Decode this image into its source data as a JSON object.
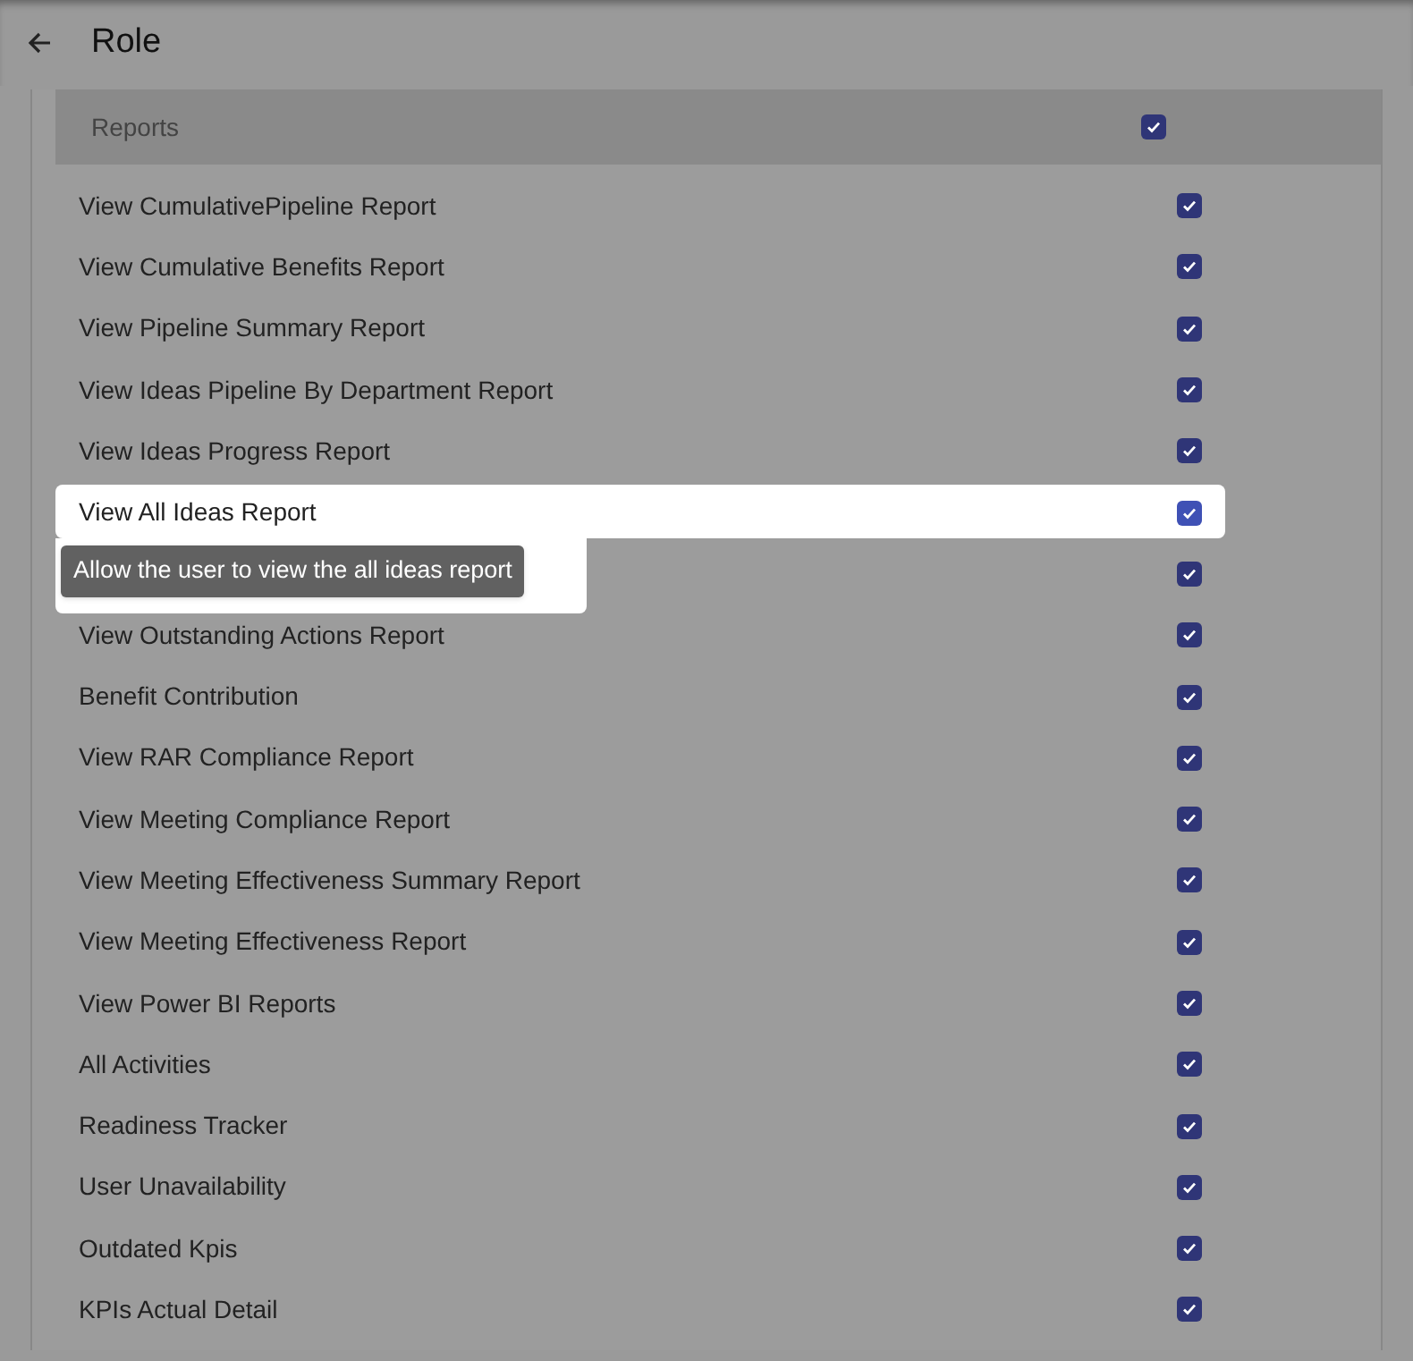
{
  "header": {
    "title": "Role"
  },
  "section": {
    "title": "Reports",
    "checked": true
  },
  "rows": [
    {
      "label": "View CumulativePipeline Report",
      "checked": true,
      "highlighted": false
    },
    {
      "label": "View Cumulative Benefits Report",
      "checked": true,
      "highlighted": false
    },
    {
      "label": "View Pipeline Summary Report",
      "checked": true,
      "highlighted": false
    },
    {
      "label": "View Ideas Pipeline By Department Report",
      "checked": true,
      "highlighted": false
    },
    {
      "label": "View Ideas Progress Report",
      "checked": true,
      "highlighted": false
    },
    {
      "label": "View All Ideas Report",
      "checked": true,
      "highlighted": true,
      "tooltip": "Allow the user to view the all ideas report"
    },
    {
      "checked": true,
      "highlighted": false
    },
    {
      "label": "View Outstanding Actions Report",
      "checked": true,
      "highlighted": false
    },
    {
      "label": "Benefit Contribution",
      "checked": true,
      "highlighted": false
    },
    {
      "label": "View RAR Compliance Report",
      "checked": true,
      "highlighted": false
    },
    {
      "label": "View Meeting Compliance Report",
      "checked": true,
      "highlighted": false
    },
    {
      "label": "View Meeting Effectiveness Summary Report",
      "checked": true,
      "highlighted": false
    },
    {
      "label": "View Meeting Effectiveness Report",
      "checked": true,
      "highlighted": false
    },
    {
      "label": "View Power BI Reports",
      "checked": true,
      "highlighted": false
    },
    {
      "label": "All Activities",
      "checked": true,
      "highlighted": false
    },
    {
      "label": "Readiness Tracker",
      "checked": true,
      "highlighted": false
    },
    {
      "label": "User Unavailability",
      "checked": true,
      "highlighted": false
    },
    {
      "label": "Outdated Kpis",
      "checked": true,
      "highlighted": false
    },
    {
      "label": "KPIs Actual Detail",
      "checked": true,
      "highlighted": false
    }
  ]
}
